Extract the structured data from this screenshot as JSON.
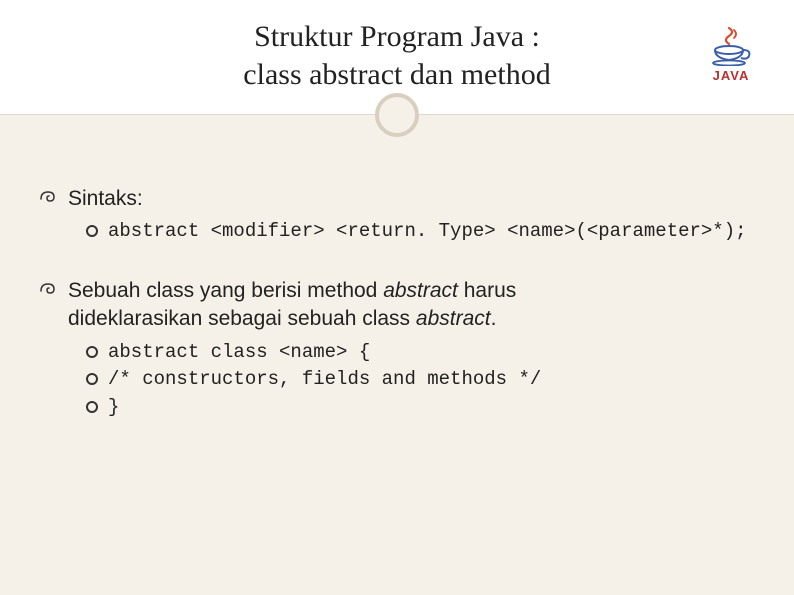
{
  "title": {
    "line1": "Struktur Program Java :",
    "line2": "class abstract dan method"
  },
  "logo": {
    "label": "JAVA"
  },
  "sections": [
    {
      "heading": "Sintaks:",
      "items": [
        "abstract <modifier> <return. Type> <name>(<parameter>*);"
      ]
    },
    {
      "heading_pre": "Sebuah class yang berisi method ",
      "heading_em": "abstract",
      "heading_post": " harus",
      "continue_pre": "dideklarasikan sebagai sebuah class ",
      "continue_em": "abstract",
      "continue_post": ".",
      "items": [
        "abstract class <name> {",
        "  /* constructors, fields and methods */",
        "}"
      ]
    }
  ]
}
